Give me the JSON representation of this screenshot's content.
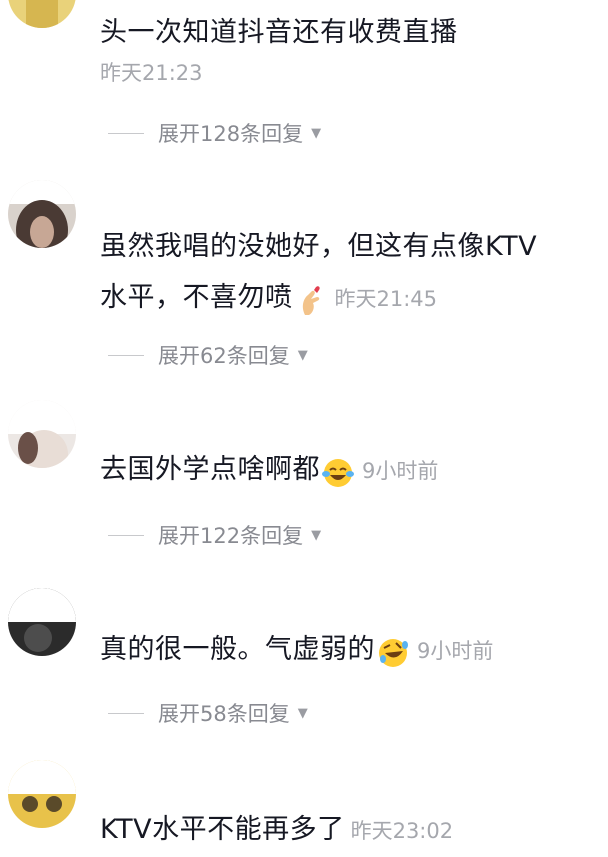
{
  "comments": [
    {
      "text": "头一次知道抖音还有收费直播",
      "time": "昨天21:23",
      "replies": "展开128条回复"
    },
    {
      "text_line1": "虽然我唱的没她好，但这有点像KTV",
      "text_line2": "水平，不喜勿喷",
      "emoji": "finger-heart-icon",
      "time": "昨天21:45",
      "replies": "展开62条回复"
    },
    {
      "text": "去国外学点啥啊都",
      "emoji": "tears-of-joy-icon",
      "time": "9小时前",
      "replies": "展开122条回复"
    },
    {
      "text": "真的很一般。气虚弱的",
      "emoji": "rolling-laughing-icon",
      "time": "9小时前",
      "replies": "展开58条回复"
    },
    {
      "text": "KTV水平不能再多了",
      "time": "昨天23:02"
    }
  ],
  "colors": {
    "text": "#161823",
    "time": "#a5a7ad",
    "replies": "#888a91"
  }
}
